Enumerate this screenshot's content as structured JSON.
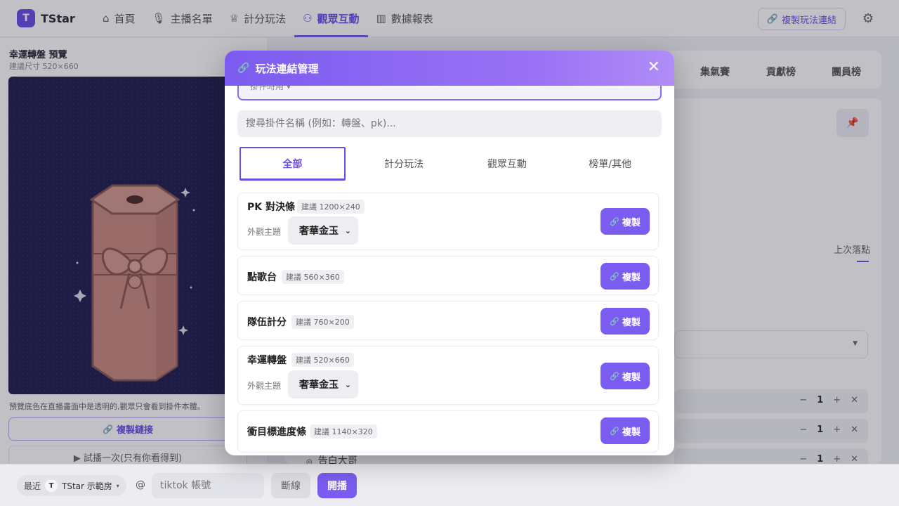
{
  "brand": {
    "logo_letter": "T",
    "name": "TStar"
  },
  "nav": {
    "items": [
      {
        "icon": "home-icon",
        "label": "首頁"
      },
      {
        "icon": "mic-icon",
        "label": "主播名單"
      },
      {
        "icon": "trophy-icon",
        "label": "計分玩法"
      },
      {
        "icon": "users-icon",
        "label": "觀眾互動"
      },
      {
        "icon": "bar-chart-icon",
        "label": "數據報表"
      }
    ],
    "active": "觀眾互動",
    "copy_link_label": "複製玩法連結"
  },
  "preview": {
    "title": "幸運轉盤 預覽",
    "size_hint": "建議尺寸 520×660",
    "note": "預覽底色在直播畫面中是透明的,觀眾只會看到掛件本體。",
    "copy_link_label": "複製鏈接",
    "trial_label": "▶ 試播一次(只有你看得到)"
  },
  "background_panel": {
    "tabs": [
      "集氣賽",
      "貢獻榜",
      "團員榜"
    ],
    "last_label": "上次落點",
    "rows": [
      {
        "count": "1"
      },
      {
        "count": "1"
      },
      {
        "count": "1"
      }
    ],
    "item_text": "告白大哥"
  },
  "bottom_bar": {
    "recent_label": "最近",
    "room_badge": "T",
    "room_name": "TStar 示範房",
    "at": "@",
    "tiktok_placeholder": "tiktok 帳號",
    "disconnect_label": "斷線",
    "start_label": "開播"
  },
  "modal": {
    "title": "玩法連結管理",
    "cut_input_text": "掛件時用 ▾",
    "search_placeholder": "搜尋掛件名稱 (例如：轉盤、pk)...",
    "tabs": [
      "全部",
      "計分玩法",
      "觀眾互動",
      "榜單/其他"
    ],
    "active_tab": "全部",
    "theme_label": "外觀主題",
    "copy_label": "複製",
    "widgets": [
      {
        "name": "PK 對決條",
        "size": "建議 1200×240",
        "theme": "奢華金玉"
      },
      {
        "name": "點歌台",
        "size": "建議 560×360"
      },
      {
        "name": "隊伍計分",
        "size": "建議 760×200"
      },
      {
        "name": "幸運轉盤",
        "size": "建議 520×660",
        "theme": "奢華金玉"
      },
      {
        "name": "衝目標進度條",
        "size": "建議 1140×320"
      }
    ]
  },
  "colors": {
    "accent": "#7b5cf0",
    "accent_dark": "#6b4de6",
    "preview_bg": "#1f1d4d"
  }
}
